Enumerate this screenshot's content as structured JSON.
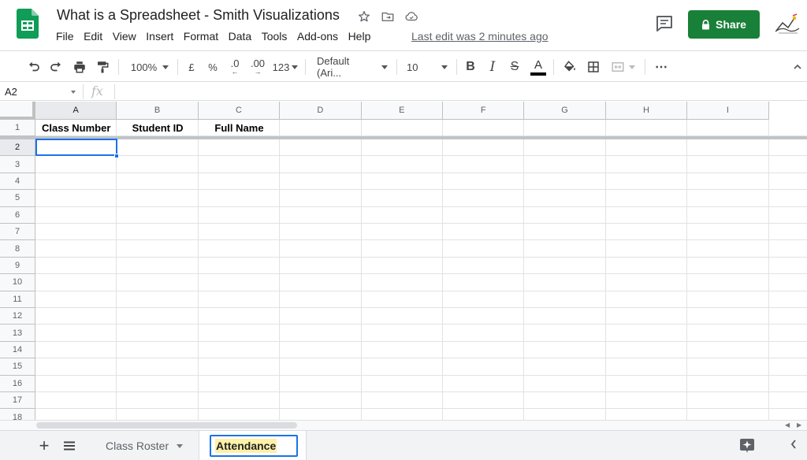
{
  "app": {
    "title": "What is a Spreadsheet - Smith Visualizations",
    "menu": [
      "File",
      "Edit",
      "View",
      "Insert",
      "Format",
      "Data",
      "Tools",
      "Add-ons",
      "Help"
    ],
    "last_edit": "Last edit was 2 minutes ago",
    "share_label": "Share"
  },
  "toolbar": {
    "zoom": "100%",
    "currency": "£",
    "percent": "%",
    "decrease_decimal": ".0",
    "increase_decimal": ".00",
    "number_format": "123",
    "font": "Default (Ari...",
    "font_size": "10",
    "more": "⋯"
  },
  "formula_bar": {
    "name_box": "A2",
    "fx": "fx",
    "value": ""
  },
  "grid": {
    "columns": [
      "A",
      "B",
      "C",
      "D",
      "E",
      "F",
      "G",
      "H",
      "I"
    ],
    "rows": [
      "1",
      "2",
      "3",
      "4",
      "5",
      "6",
      "7",
      "8",
      "9",
      "10",
      "11",
      "12",
      "13",
      "14",
      "15",
      "16",
      "17",
      "18"
    ],
    "header_cells": [
      "Class Number",
      "Student ID",
      "Full Name"
    ],
    "selected_cell": "A2"
  },
  "sheets": {
    "tabs": [
      {
        "label": "Class Roster",
        "active": false
      },
      {
        "label": "Attendance",
        "active": true,
        "editing": true
      }
    ]
  },
  "colors": {
    "share": "#188038",
    "selection": "#1a73e8",
    "sheets_green": "#0f9d58"
  }
}
